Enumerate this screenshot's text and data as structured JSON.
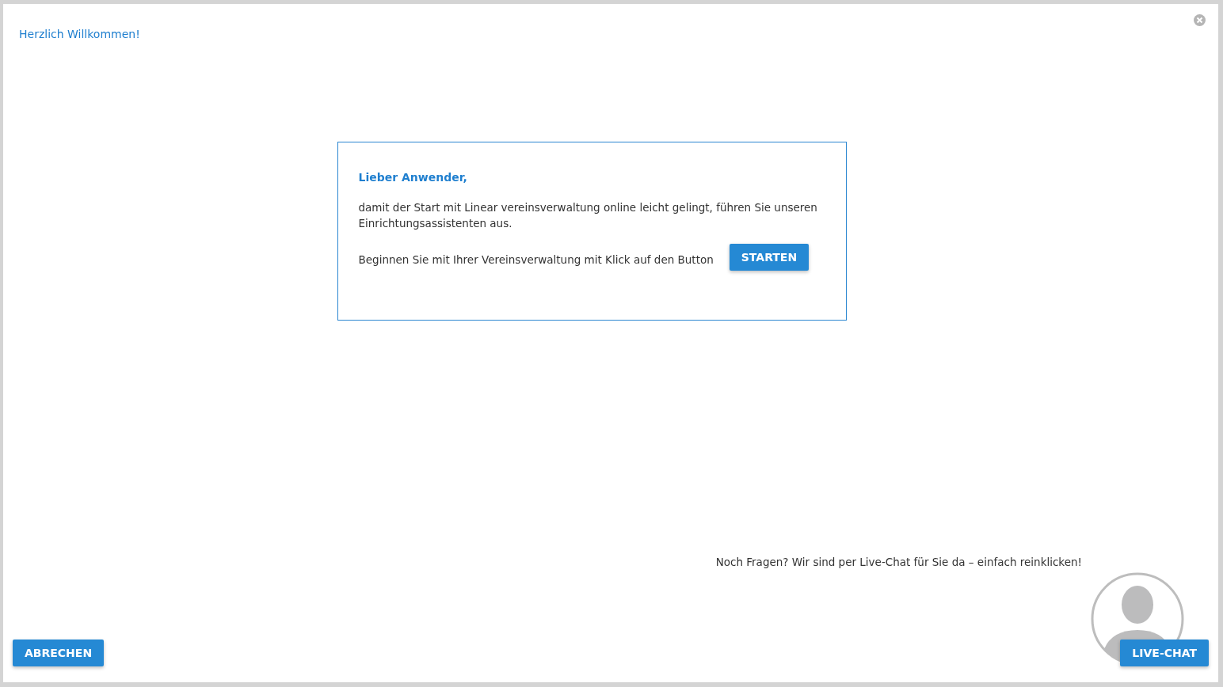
{
  "dialog": {
    "title": "Herzlich Willkommen!"
  },
  "welcome_box": {
    "greeting": "Lieber Anwender,",
    "intro": "damit der Start mit Linear vereinsverwaltung online leicht gelingt, führen Sie unseren Einrichtungsassistenten aus.",
    "prompt": "Beginnen Sie mit Ihrer Vereinsverwaltung mit Klick auf den Button",
    "start_button": "STARTEN"
  },
  "chat_hint": "Noch Fragen? Wir sind per Live-Chat für Sie da – einfach reinklicken!",
  "buttons": {
    "cancel": "ABRECHEN",
    "live_chat": "LIVE-CHAT"
  }
}
